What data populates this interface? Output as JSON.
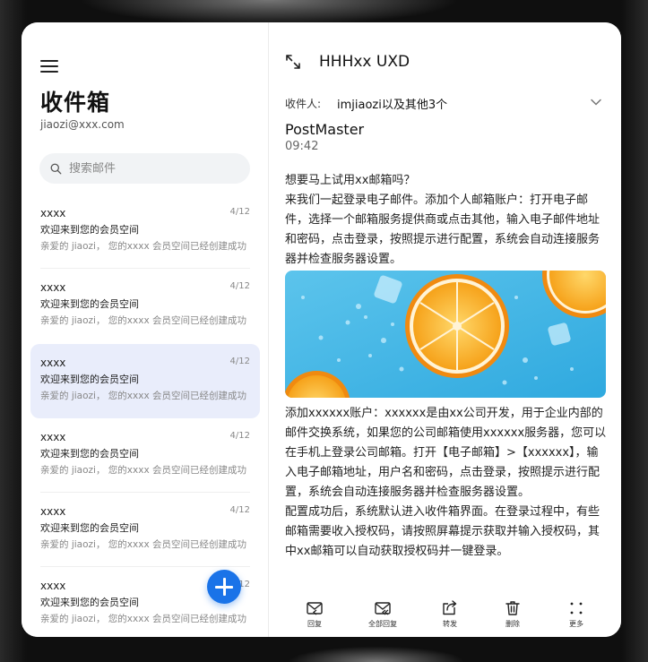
{
  "left": {
    "title": "收件箱",
    "account": "jiaozi@xxx.com",
    "search": {
      "placeholder": "搜索邮件"
    },
    "mails": [
      {
        "sender": "xxxx",
        "date": "4/12",
        "subject": "欢迎来到您的会员空间",
        "preview": "亲爱的 jiaozi，   您的xxxx 会员空间已经创建成功"
      },
      {
        "sender": "xxxx",
        "date": "4/12",
        "subject": "欢迎来到您的会员空间",
        "preview": "亲爱的 jiaozi，   您的xxxx 会员空间已经创建成功"
      },
      {
        "sender": "xxxx",
        "date": "4/12",
        "subject": "欢迎来到您的会员空间",
        "preview": "亲爱的 jiaozi，   您的xxxx 会员空间已经创建成功"
      },
      {
        "sender": "xxxx",
        "date": "4/12",
        "subject": "欢迎来到您的会员空间",
        "preview": "亲爱的 jiaozi，   您的xxxx 会员空间已经创建成功"
      },
      {
        "sender": "xxxx",
        "date": "4/12",
        "subject": "欢迎来到您的会员空间",
        "preview": "亲爱的 jiaozi，   您的xxxx 会员空间已经创建成功"
      },
      {
        "sender": "xxxx",
        "date": "4/12",
        "subject": "欢迎来到您的会员空间",
        "preview": "亲爱的 jiaozi，   您的xxxx 会员空间已经创建成功"
      }
    ]
  },
  "detail": {
    "title": "HHHxx UXD",
    "recipients_label": "收件人:",
    "recipients": "imjiaozi以及其他3个",
    "from": "PostMaster",
    "time": "09:42",
    "paragraph1": "想要马上试用xx邮箱吗？\n来我们一起登录电子邮件。添加个人邮箱账户：打开电子邮件，选择一个邮箱服务提供商或点击其他，输入电子邮件地址和密码，点击登录，按照提示进行配置，系统会自动连接服务器并检查服务器设置。",
    "paragraph2": "添加xxxxxx账户：xxxxxx是由xx公司开发，用于企业内部的邮件交换系统，如果您的公司邮箱使用xxxxxx服务器，您可以在手机上登录公司邮箱。打开【电子邮箱】>【xxxxxx】，输入电子邮箱地址，用户名和密码，点击登录，按照提示进行配置，系统会自动连接服务器并检查服务器设置。\n配置成功后，系统默认进入收件箱界面。在登录过程中，有些邮箱需要收入授权码，请按照屏幕提示获取并输入授权码，其中xx邮箱可以自动获取授权码并一键登录。"
  },
  "toolbar": {
    "reply": "回复",
    "reply_all": "全部回复",
    "forward": "转发",
    "delete": "删除",
    "more": "更多"
  },
  "colors": {
    "accent": "#1a73e8",
    "selected_row": "#e9edfb",
    "image_bg": "#4ab8e6",
    "orange": "#f6a21a"
  }
}
